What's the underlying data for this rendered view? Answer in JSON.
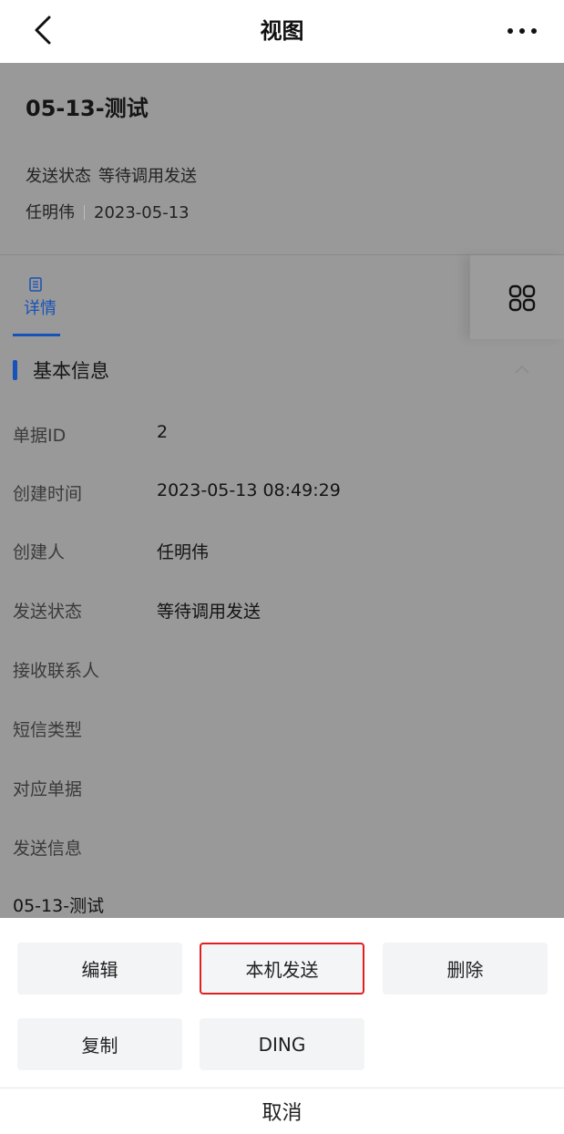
{
  "nav": {
    "title": "视图",
    "back_icon": "chevron-left-icon",
    "more_icon": "more-dots-icon"
  },
  "header": {
    "doc_title": "05-13-测试",
    "status_label": "发送状态",
    "status_value": "等待调用发送",
    "creator": "任明伟",
    "date": "2023-05-13"
  },
  "tabs": {
    "detail_label": "详情",
    "detail_icon": "list-doc-icon",
    "grid_icon": "grid-icon"
  },
  "section": {
    "title": "基本信息",
    "chevron_icon": "chevron-up-icon"
  },
  "fields": [
    {
      "label": "单据ID",
      "value": "2"
    },
    {
      "label": "创建时间",
      "value": "2023-05-13 08:49:29"
    },
    {
      "label": "创建人",
      "value": "任明伟"
    },
    {
      "label": "发送状态",
      "value": "等待调用发送"
    },
    {
      "label": "接收联系人",
      "value": ""
    },
    {
      "label": "短信类型",
      "value": ""
    },
    {
      "label": "对应单据",
      "value": ""
    },
    {
      "label": "发送信息",
      "value": ""
    }
  ],
  "message_text": "05-13-测试",
  "sheet": {
    "actions": [
      "编辑",
      "本机发送",
      "删除",
      "复制",
      "DING"
    ],
    "cancel": "取消"
  },
  "colors": {
    "accent": "#1652b8",
    "overlay": "#999999",
    "highlight_border": "#e02020"
  }
}
